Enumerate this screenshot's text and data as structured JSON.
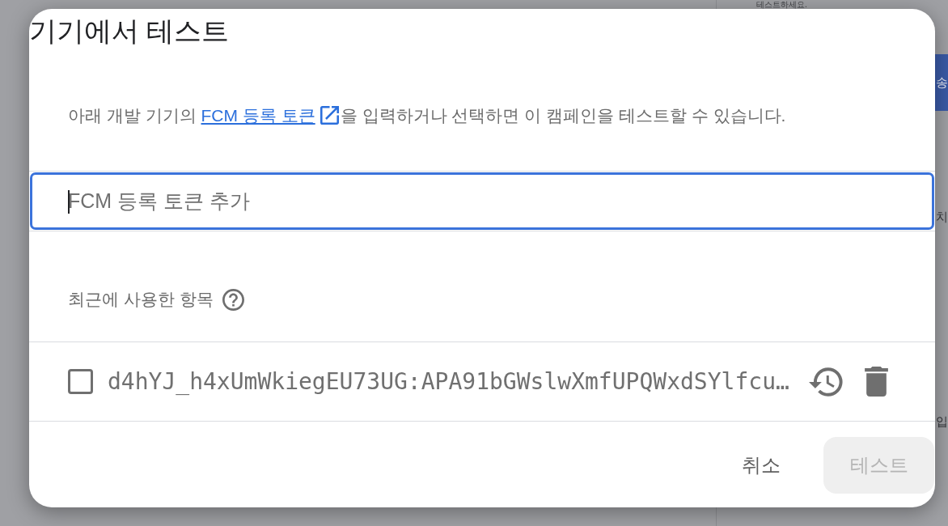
{
  "background": {
    "side_panel": {
      "text": "테스트하세요.",
      "button": "송",
      "labels": [
        "치",
        "입"
      ]
    }
  },
  "dialog": {
    "title": "기기에서 테스트",
    "description": {
      "before": "아래 개발 기기의 ",
      "link": "FCM 등록 토큰",
      "after": "을 입력하거나 선택하면 이 캠페인을 테스트할 수 있습니다."
    },
    "token_field": {
      "placeholder": "FCM 등록 토큰 추가",
      "focused": true
    },
    "recent": {
      "label": "최근에 사용한 항목"
    },
    "tokens": [
      {
        "value": "d4hYJ_h4xUmWkiegEU73UG:APA91bGWslwXmfUPQWxdSYlfcu…",
        "checked": false
      }
    ],
    "buttons": [
      {
        "label": "취소",
        "kind": "text",
        "disabled": false
      },
      {
        "label": "테스트",
        "kind": "filled",
        "disabled": true
      }
    ]
  }
}
